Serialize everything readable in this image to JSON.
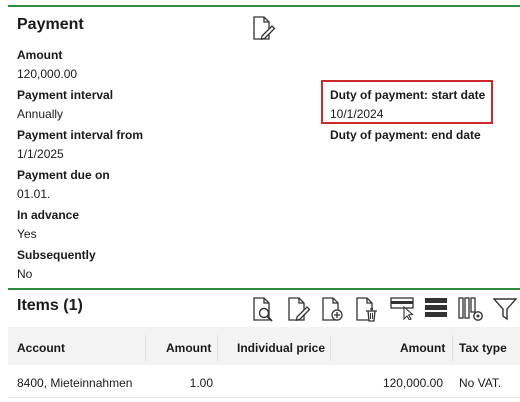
{
  "payment": {
    "title": "Payment",
    "header_icon": "edit-document-icon",
    "fields": [
      {
        "label": "Amount",
        "value": "120,000.00"
      },
      {
        "label": "Payment interval",
        "value": "Annually"
      },
      {
        "label": "Payment interval from",
        "value": "1/1/2025"
      },
      {
        "label": "Payment due on",
        "value": "01.01."
      },
      {
        "label": "In advance",
        "value": "Yes"
      },
      {
        "label": "Subsequently",
        "value": "No"
      }
    ],
    "duty_start": {
      "label": "Duty of payment: start date",
      "value": "10/1/2024"
    },
    "duty_end": {
      "label": "Duty of payment: end date",
      "value": ""
    }
  },
  "items": {
    "title": "Items (1)",
    "toolbar_icons": [
      "document-search-icon",
      "document-edit-icon",
      "document-add-icon",
      "document-delete-icon",
      "card-select-icon",
      "rows-icon",
      "column-settings-icon",
      "filter-icon"
    ],
    "columns": [
      "Account",
      "Amount",
      "Individual price",
      "Amount",
      "Tax type"
    ],
    "rows": [
      {
        "account": "8400, Mieteinnahmen",
        "amount": "1.00",
        "individual_price": "",
        "total": "120,000.00",
        "tax_type": "No VAT."
      }
    ]
  },
  "colors": {
    "accent_line": "#2e8b3e",
    "highlight": "#cc2a2a"
  }
}
